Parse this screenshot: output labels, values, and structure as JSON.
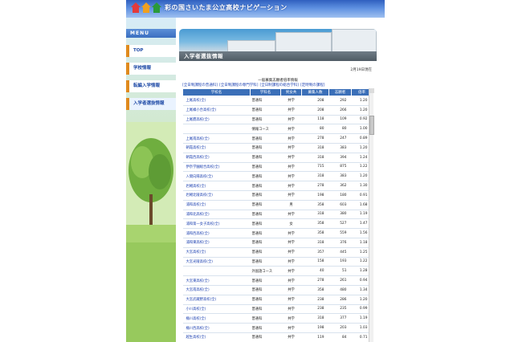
{
  "header": {
    "site_title": "彩の国さいたま公立高校ナビゲーション",
    "icon_colors": [
      "#e23b3b",
      "#f0a020",
      "#2a9a3a"
    ]
  },
  "sidebar": {
    "menu_label": "MENU",
    "items": [
      {
        "label": "TOP",
        "active": false
      },
      {
        "label": "学校情報",
        "active": false
      },
      {
        "label": "転編入学情報",
        "active": false
      },
      {
        "label": "入学者選抜情報",
        "active": true
      }
    ]
  },
  "main": {
    "section_title": "入学者選抜情報",
    "date_note": "2月19日現在",
    "subtitle": "一般募集志願者倍率情報",
    "links": [
      "[全日制課程の普通科]",
      "[全日制課程の専門学科]",
      "[全日制課程の総合学科]",
      "[定時制の課程]"
    ],
    "table": {
      "headers": [
        "学校名",
        "学科名",
        "男女共",
        "募集人数",
        "志願者",
        "倍率"
      ],
      "rows": [
        [
          "上尾高校(全)",
          "普通科",
          "共学",
          "208",
          "292",
          "1.20"
        ],
        [
          "上尾橘小合高校(全)",
          "普通科",
          "共学",
          "208",
          "266",
          "1.20"
        ],
        [
          "上尾鷹高校(全)",
          "普通科",
          "共学",
          "118",
          "109",
          "0.92"
        ],
        [
          "",
          "情報コース",
          "共学",
          "80",
          "80",
          "1.00"
        ],
        [
          "上尾南高校(全)",
          "普通科",
          "共学",
          "278",
          "247",
          "0.89"
        ],
        [
          "朝霞高校(全)",
          "普通科",
          "共学",
          "318",
          "383",
          "1.20"
        ],
        [
          "朝霞西高校(全)",
          "普通科",
          "共学",
          "318",
          "394",
          "1.24"
        ],
        [
          "伊奈学園総合高校(全)",
          "普通科",
          "共学",
          "715",
          "875",
          "1.22"
        ],
        [
          "入間向陽高校(全)",
          "普通科",
          "共学",
          "318",
          "383",
          "1.20"
        ],
        [
          "岩槻高校(全)",
          "普通科",
          "共学",
          "278",
          "362",
          "1.30"
        ],
        [
          "岩槻北陵高校(全)",
          "普通科",
          "共学",
          "198",
          "180",
          "0.91"
        ],
        [
          "浦和高校(全)",
          "普通科",
          "男",
          "358",
          "603",
          "1.68"
        ],
        [
          "浦和北高校(全)",
          "普通科",
          "共学",
          "318",
          "380",
          "1.19"
        ],
        [
          "浦和第一女子高校(全)",
          "普通科",
          "女",
          "358",
          "527",
          "1.47"
        ],
        [
          "浦和西高校(全)",
          "普通科",
          "共学",
          "358",
          "559",
          "1.56"
        ],
        [
          "浦和東高校(全)",
          "普通科",
          "共学",
          "318",
          "376",
          "1.18"
        ],
        [
          "大宮高校(全)",
          "普通科",
          "共学",
          "357",
          "445",
          "1.25"
        ],
        [
          "大宮光陵高校(全)",
          "普通科",
          "共学",
          "158",
          "193",
          "1.22"
        ],
        [
          "",
          "外国語コース",
          "共学",
          "40",
          "51",
          "1.28"
        ],
        [
          "大宮東高校(全)",
          "普通科",
          "共学",
          "278",
          "261",
          "0.94"
        ],
        [
          "大宮南高校(全)",
          "普通科",
          "共学",
          "358",
          "480",
          "1.34"
        ],
        [
          "大宮武蔵野高校(全)",
          "普通科",
          "共学",
          "238",
          "286",
          "1.20"
        ],
        [
          "小川高校(全)",
          "普通科",
          "共学",
          "238",
          "235",
          "0.99"
        ],
        [
          "桶川高校(全)",
          "普通科",
          "共学",
          "318",
          "377",
          "1.19"
        ],
        [
          "桶川西高校(全)",
          "普通科",
          "共学",
          "198",
          "203",
          "1.03"
        ],
        [
          "越生高校(全)",
          "普通科",
          "共学",
          "119",
          "84",
          "0.71"
        ]
      ]
    }
  }
}
